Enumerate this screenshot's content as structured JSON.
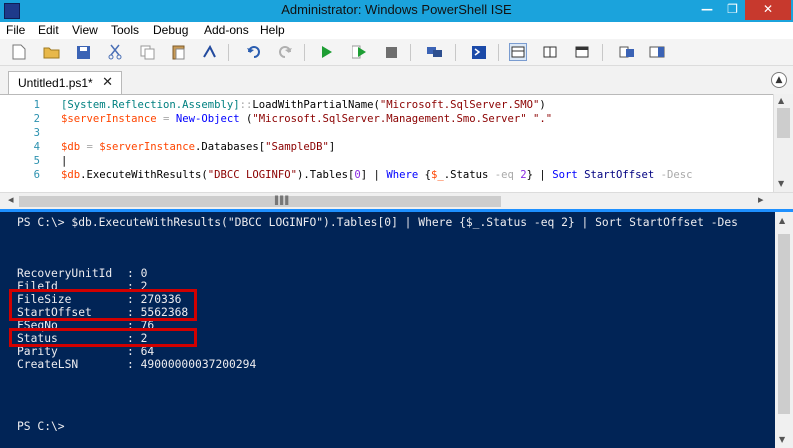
{
  "window": {
    "title": "Administrator: Windows PowerShell ISE",
    "controls": {
      "minimize": "—",
      "maximize": "❐",
      "close": "✕"
    }
  },
  "menubar": {
    "items": [
      "File",
      "Edit",
      "View",
      "Tools",
      "Debug",
      "Add-ons",
      "Help"
    ]
  },
  "toolbar": {
    "icons": [
      "new-file-icon",
      "open-file-icon",
      "save-icon",
      "cut-icon",
      "copy-icon",
      "paste-icon",
      "clear-console-icon",
      "undo-icon",
      "redo-icon",
      "run-script-icon",
      "run-selection-icon",
      "stop-icon",
      "new-remote-tab-icon",
      "powershell-console-icon",
      "show-script-top-icon",
      "show-script-right-icon",
      "show-script-max-icon",
      "show-command-window-icon",
      "show-command-addon-icon"
    ]
  },
  "tabs": [
    {
      "label": "Untitled1.ps1*",
      "close": "✕"
    }
  ],
  "editor": {
    "line_numbers": [
      "1",
      "2",
      "3",
      "4",
      "5",
      "6"
    ],
    "lines": [
      {
        "type_name": "[System.Reflection.Assembly]",
        "op": "::",
        "method": "LoadWithPartialName(",
        "string": "\"Microsoft.SqlServer.SMO\"",
        "tail": ")"
      },
      {
        "var": "$serverInstance",
        "op": " = ",
        "cmd": "New-Object",
        "paren": " (",
        "string": "\"Microsoft.SqlServer.Management.Smo.Server\"",
        "str2": " \".\""
      },
      {
        "empty": ""
      },
      {
        "var": "$db",
        "op": " = ",
        "var2": "$serverInstance",
        "prop": ".Databases[",
        "string": "\"SampleDB\"",
        "tail": "]"
      },
      {
        "empty": "|"
      },
      {
        "var": "$db",
        "method": ".ExecuteWithResults(",
        "string": "\"DBCC LOGINFO\"",
        "tail": ").Tables[",
        "num": "0",
        "tail2": "] | ",
        "cmd": "Where",
        "brace": " {",
        "var2": "$_",
        "prop": ".Status ",
        "op": "-eq",
        "num2": " 2",
        "tail3": "} | ",
        "cmd2": "Sort",
        "arg": " StartOffset",
        "param": " -Desc"
      }
    ]
  },
  "hscroll": {
    "left": "◂",
    "grip": "▌▌▌",
    "right": "▸"
  },
  "console": {
    "prompt_line": "PS C:\\> $db.ExecuteWithResults(\"DBCC LOGINFO\").Tables[0] | Where {$_.Status -eq 2} | Sort StartOffset -Des",
    "fields": [
      {
        "name": "RecoveryUnitId",
        "sep": ":",
        "value": "0"
      },
      {
        "name": "FileId",
        "sep": ":",
        "value": "2"
      },
      {
        "name": "FileSize",
        "sep": ":",
        "value": "270336"
      },
      {
        "name": "StartOffset",
        "sep": ":",
        "value": "5562368"
      },
      {
        "name": "FSeqNo",
        "sep": ":",
        "value": "76"
      },
      {
        "name": "Status",
        "sep": ":",
        "value": "2"
      },
      {
        "name": "Parity",
        "sep": ":",
        "value": "64"
      },
      {
        "name": "CreateLSN",
        "sep": ":",
        "value": "49000000037200294"
      }
    ],
    "final_prompt": "PS C:\\>"
  },
  "colors": {
    "titlebar": "#1ba3dc",
    "console_bg": "#012456",
    "highlight": "#d10000",
    "close_button": "#c7392d"
  }
}
